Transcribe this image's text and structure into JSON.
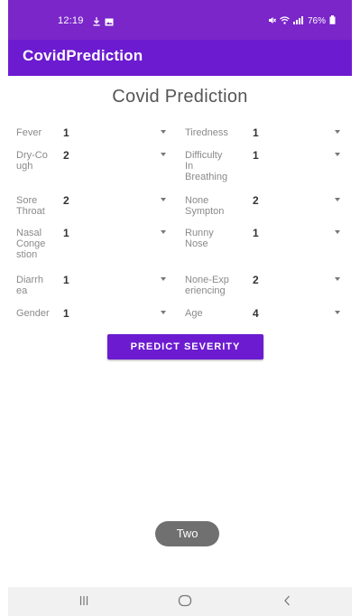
{
  "status_bar": {
    "time": "12:19",
    "battery_text": "76%",
    "left_icons": [
      "download-icon",
      "image-icon"
    ],
    "right_icons": [
      "mute-icon",
      "wifi-icon",
      "signal-icon",
      "battery-icon"
    ]
  },
  "app_bar": {
    "title": "CovidPrediction"
  },
  "main": {
    "title": "Covid Prediction",
    "fields": [
      {
        "label": "Fever",
        "value": "1"
      },
      {
        "label": "Tiredness",
        "value": "1"
      },
      {
        "label": "Dry-Co\nugh",
        "value": "2"
      },
      {
        "label": "Difficulty\nIn\nBreathing",
        "value": "1"
      },
      {
        "label": "Sore\nThroat",
        "value": "2"
      },
      {
        "label": "None\nSympton",
        "value": "2"
      },
      {
        "label": "Nasal\nConge\nstion",
        "value": "1"
      },
      {
        "label": "Runny\nNose",
        "value": "1"
      },
      {
        "label": "Diarrh\nea",
        "value": "1"
      },
      {
        "label": "None-Exp\neriencing",
        "value": "2"
      },
      {
        "label": "Gender",
        "value": "1"
      },
      {
        "label": "Age",
        "value": "4"
      }
    ],
    "predict_button": "PREDICT SEVERITY",
    "toast": "Two"
  },
  "nav_bar": {
    "icons": [
      "recents-icon",
      "home-icon",
      "back-icon"
    ]
  },
  "colors": {
    "primary": "#6c1bd0",
    "status_bar": "#7a26c9",
    "toast": "#707070"
  }
}
